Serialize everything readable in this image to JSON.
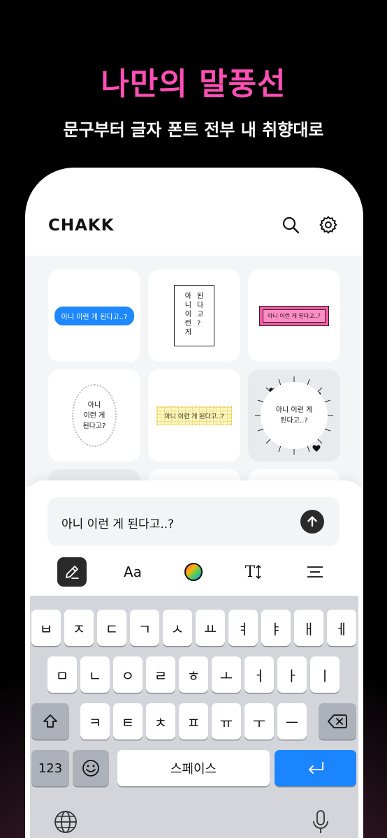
{
  "promo": {
    "title": "나만의 말풍선",
    "subtitle": "문구부터 글자 폰트 전부 내 취향대로"
  },
  "app": {
    "brand": "CHAKK",
    "search_icon": "search-icon",
    "settings_icon": "gear-icon"
  },
  "bubbles": {
    "b1": "아니 이런 게 된다고..?",
    "b2_col1": [
      "아",
      "니",
      "이",
      "런",
      "게"
    ],
    "b2_col2": [
      "된",
      "다",
      "고",
      "?"
    ],
    "b3": "아니 이런 게 된다고..?",
    "b4_line1": "아니",
    "b4_line2": "이런 게",
    "b4_line3": "된다고?",
    "b5": "아니 이런 게 된다고..?",
    "b6_line1": "아니 이런 게",
    "b6_line2": "된다고..?"
  },
  "composer": {
    "text": "아니 이런 게 된다고..?",
    "send_icon": "arrow-up-icon"
  },
  "toolbar": {
    "edit_icon": "pencil-icon",
    "font_label": "Aa",
    "color_icon": "color-wheel-icon",
    "size_label": "T",
    "align_icon": "align-center-icon"
  },
  "keyboard": {
    "row1": [
      "ㅂ",
      "ㅈ",
      "ㄷ",
      "ㄱ",
      "ㅅ",
      "ㅛ",
      "ㅕ",
      "ㅑ",
      "ㅐ",
      "ㅔ"
    ],
    "row2": [
      "ㅁ",
      "ㄴ",
      "ㅇ",
      "ㄹ",
      "ㅎ",
      "ㅗ",
      "ㅓ",
      "ㅏ",
      "ㅣ"
    ],
    "row3": [
      "ㅋ",
      "ㅌ",
      "ㅊ",
      "ㅍ",
      "ㅠ",
      "ㅜ",
      "ㅡ"
    ],
    "numbers_label": "123",
    "space_label": "스페이스",
    "shift_icon": "shift-icon",
    "backspace_icon": "backspace-icon",
    "emoji_icon": "emoji-icon",
    "return_icon": "return-icon",
    "globe_icon": "globe-icon",
    "mic_icon": "microphone-icon"
  },
  "colors": {
    "accent_pink": "#ff4fb6",
    "ios_blue": "#1a85ff"
  }
}
